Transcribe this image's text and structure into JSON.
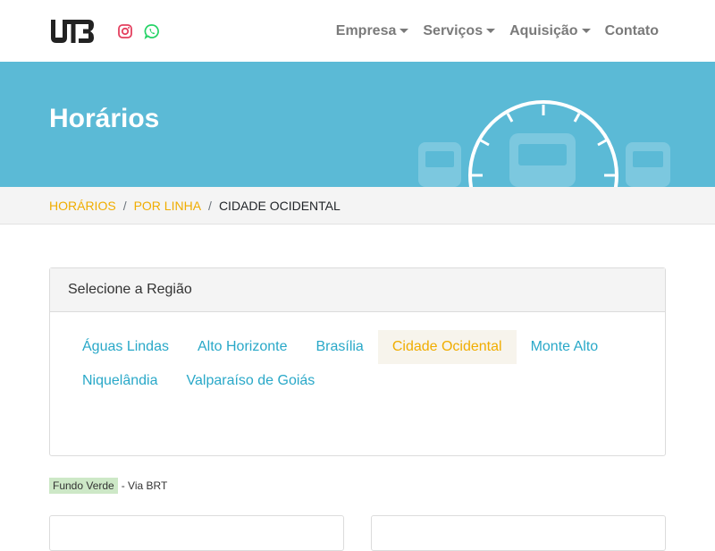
{
  "brand": {
    "logo_icon": "utb-logo"
  },
  "social": [
    {
      "icon": "instagram-icon",
      "color": "#e4405f"
    },
    {
      "icon": "whatsapp-icon",
      "color": "#25d366"
    }
  ],
  "nav": {
    "items": [
      {
        "label": "Empresa",
        "dropdown": true
      },
      {
        "label": "Serviços",
        "dropdown": true
      },
      {
        "label": "Aquisição",
        "dropdown": true
      },
      {
        "label": "Contato",
        "dropdown": false
      }
    ]
  },
  "hero": {
    "title": "Horários",
    "bg_color": "#5bbad6"
  },
  "breadcrumb": {
    "items": [
      "HORÁRIOS",
      "POR LINHA"
    ],
    "current": "CIDADE OCIDENTAL"
  },
  "region_card": {
    "title": "Selecione a Região",
    "regions": [
      "Águas Lindas",
      "Alto Horizonte",
      "Brasília",
      "Cidade Ocidental",
      "Monte Alto",
      "Niquelândia",
      "Valparaíso de Goiás"
    ],
    "active": "Cidade Ocidental"
  },
  "legend": {
    "tag": "Fundo Verde",
    "text": "- Via BRT"
  },
  "colors": {
    "accent": "#f0ad00",
    "link": "#29a8c8",
    "brt_green": "#cde8c7"
  }
}
